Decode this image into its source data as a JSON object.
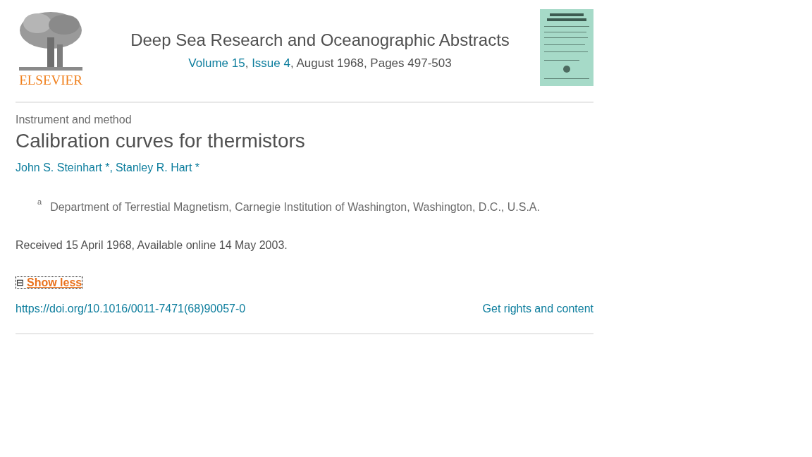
{
  "header": {
    "publisher": "ELSEVIER",
    "journal_title": "Deep Sea Research and Oceanographic Abstracts",
    "volume_link": "Volume 15",
    "volume_separator": ",",
    "issue_link": "Issue 4",
    "issue_info": ", August 1968, Pages 497-503"
  },
  "article": {
    "type": "Instrument and method",
    "title": "Calibration curves for thermistors",
    "authors": [
      {
        "name": "John S. Steinhart",
        "mark": "*",
        "separator": ","
      },
      {
        "name": "Stanley R. Hart",
        "mark": "*"
      }
    ],
    "affiliation": {
      "label": "a",
      "text": "Department of Terrestial Magnetism, Carnegie Institution of Washington, Washington, D.C., U.S.A."
    },
    "history": "Received 15 April 1968, Available online 14 May 2003.",
    "toggle": {
      "icon": "⊟",
      "label": "Show less",
      "expanded": true
    },
    "doi": "https://doi.org/10.1016/0011-7471(68)90057-0",
    "rights_link": "Get rights and content"
  }
}
